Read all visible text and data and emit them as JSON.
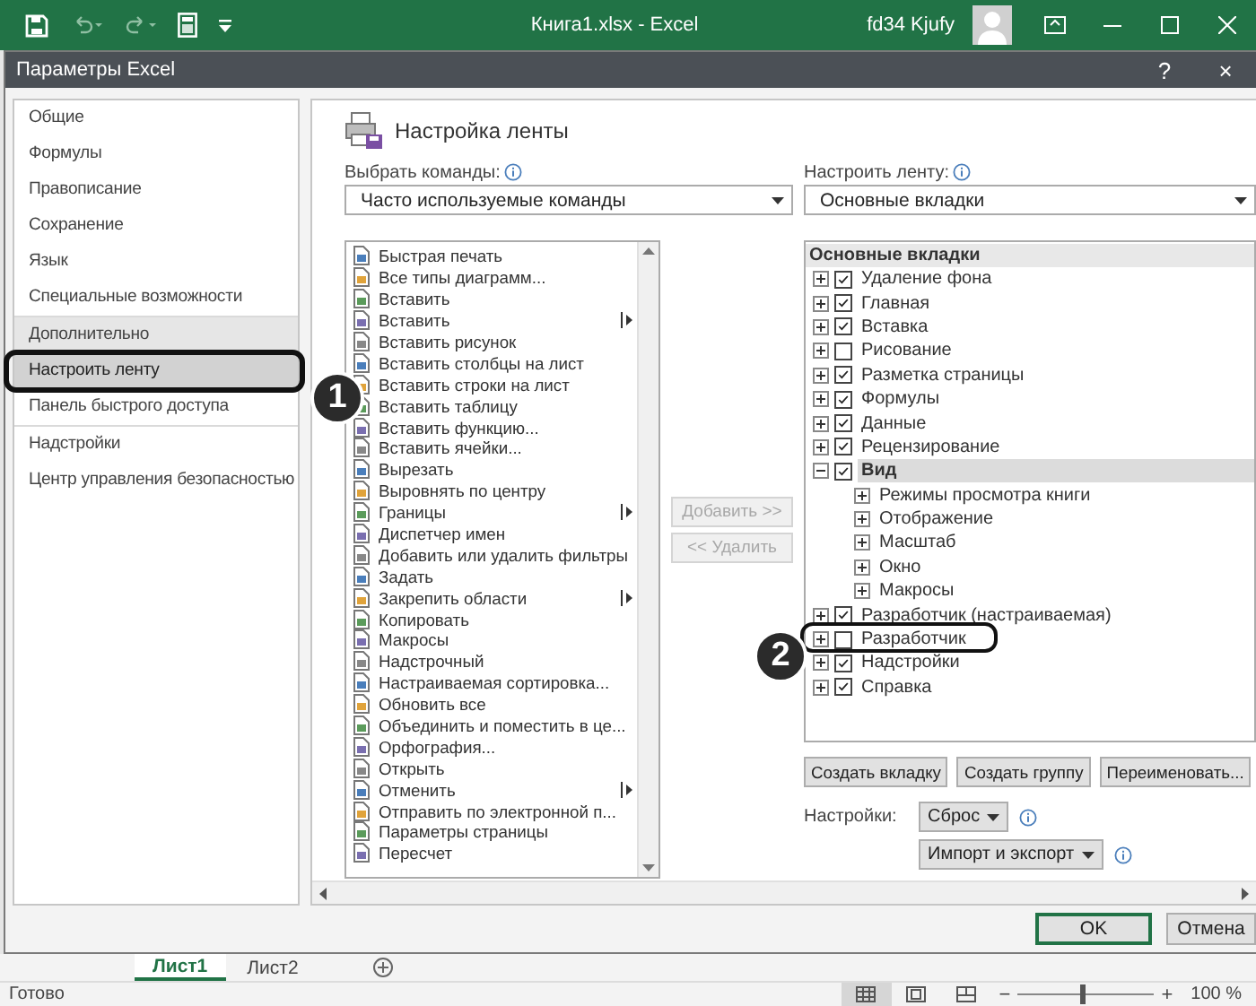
{
  "title_bar": {
    "title": "Книга1.xlsx  -  Excel",
    "user": "fd34 Kjufy"
  },
  "dialog": {
    "title": "Параметры Excel",
    "help": "?",
    "close": "×"
  },
  "nav_groups": [
    {
      "items": [
        {
          "label": "Общие",
          "selected": false,
          "highlighted": false
        },
        {
          "label": "Формулы",
          "selected": false,
          "highlighted": false
        },
        {
          "label": "Правописание",
          "selected": false,
          "highlighted": false
        },
        {
          "label": "Сохранение",
          "selected": false,
          "highlighted": false
        },
        {
          "label": "Язык",
          "selected": false,
          "highlighted": false
        },
        {
          "label": "Специальные возможности",
          "selected": false,
          "highlighted": false
        }
      ]
    },
    {
      "items": [
        {
          "label": "Дополнительно",
          "selected": false,
          "highlighted": true
        },
        {
          "label": "Настроить ленту",
          "selected": true,
          "highlighted": false
        },
        {
          "label": "Панель быстрого доступа",
          "selected": false,
          "highlighted": false
        }
      ]
    },
    {
      "items": [
        {
          "label": "Надстройки",
          "selected": false,
          "highlighted": false
        },
        {
          "label": "Центр управления безопасностью",
          "selected": false,
          "highlighted": false
        }
      ]
    }
  ],
  "section_title": "Настройка ленты",
  "commands": {
    "label": "Выбрать команды:",
    "dropdown": "Часто используемые команды",
    "items": [
      {
        "label": "Быстрая печать",
        "has_submenu": false
      },
      {
        "label": "Все типы диаграмм...",
        "has_submenu": false
      },
      {
        "label": "Вставить",
        "has_submenu": false
      },
      {
        "label": "Вставить",
        "has_submenu": true
      },
      {
        "label": "Вставить рисунок",
        "has_submenu": false
      },
      {
        "label": "Вставить столбцы на лист",
        "has_submenu": false
      },
      {
        "label": "Вставить строки на лист",
        "has_submenu": false
      },
      {
        "label": "Вставить таблицу",
        "has_submenu": false
      },
      {
        "label": "Вставить функцию...",
        "has_submenu": false
      },
      {
        "label": "Вставить ячейки...",
        "has_submenu": false
      },
      {
        "label": "Вырезать",
        "has_submenu": false
      },
      {
        "label": "Выровнять по центру",
        "has_submenu": false
      },
      {
        "label": "Границы",
        "has_submenu": true
      },
      {
        "label": "Диспетчер имен",
        "has_submenu": false
      },
      {
        "label": "Добавить или удалить фильтры",
        "has_submenu": false
      },
      {
        "label": "Задать",
        "has_submenu": false
      },
      {
        "label": "Закрепить области",
        "has_submenu": true
      },
      {
        "label": "Копировать",
        "has_submenu": false
      },
      {
        "label": "Макросы",
        "has_submenu": false
      },
      {
        "label": "Надстрочный",
        "has_submenu": false
      },
      {
        "label": "Настраиваемая сортировка...",
        "has_submenu": false
      },
      {
        "label": "Обновить все",
        "has_submenu": false
      },
      {
        "label": "Объединить и поместить в це...",
        "has_submenu": false
      },
      {
        "label": "Орфография...",
        "has_submenu": false
      },
      {
        "label": "Открыть",
        "has_submenu": false
      },
      {
        "label": "Отменить",
        "has_submenu": true
      },
      {
        "label": "Отправить по электронной п...",
        "has_submenu": false
      },
      {
        "label": "Параметры страницы",
        "has_submenu": false
      },
      {
        "label": "Пересчет",
        "has_submenu": false
      }
    ]
  },
  "add_button": {
    "label": "Добавить >>",
    "disabled": true
  },
  "remove_button": {
    "label": "<< Удалить",
    "disabled": true
  },
  "ribbon": {
    "label": "Настроить ленту:",
    "dropdown": "Основные вкладки",
    "tree_header": "Основные вкладки",
    "tabs": [
      {
        "label": "Удаление фона",
        "checked": true,
        "expanded": false,
        "selected": false
      },
      {
        "label": "Главная",
        "checked": true,
        "expanded": false,
        "selected": false
      },
      {
        "label": "Вставка",
        "checked": true,
        "expanded": false,
        "selected": false
      },
      {
        "label": "Рисование",
        "checked": false,
        "expanded": false,
        "selected": false
      },
      {
        "label": "Разметка страницы",
        "checked": true,
        "expanded": false,
        "selected": false
      },
      {
        "label": "Формулы",
        "checked": true,
        "expanded": false,
        "selected": false
      },
      {
        "label": "Данные",
        "checked": true,
        "expanded": false,
        "selected": false
      },
      {
        "label": "Рецензирование",
        "checked": true,
        "expanded": false,
        "selected": false
      },
      {
        "label": "Вид",
        "checked": true,
        "expanded": true,
        "selected": true,
        "children": [
          {
            "label": "Режимы просмотра книги",
            "expanded": false
          },
          {
            "label": "Отображение",
            "expanded": false
          },
          {
            "label": "Масштаб",
            "expanded": false
          },
          {
            "label": "Окно",
            "expanded": false
          },
          {
            "label": "Макросы",
            "expanded": false
          }
        ]
      },
      {
        "label": "Разработчик (настраиваемая)",
        "checked": true,
        "expanded": false,
        "selected": false
      },
      {
        "label": "Разработчик",
        "checked": false,
        "expanded": false,
        "selected": false
      },
      {
        "label": "Надстройки",
        "checked": true,
        "expanded": false,
        "selected": false
      },
      {
        "label": "Справка",
        "checked": true,
        "expanded": false,
        "selected": false
      }
    ]
  },
  "ribbon_buttons": [
    "Создать вкладку",
    "Создать группу",
    "Переименовать..."
  ],
  "settings": {
    "label": "Настройки:",
    "reset": "Сброс",
    "import_export": "Импорт и экспорт"
  },
  "footer_buttons": [
    {
      "label": "OK",
      "default": true
    },
    {
      "label": "Отмена",
      "default": false
    }
  ],
  "sheets": [
    {
      "label": "Лист1",
      "selected": true
    },
    {
      "label": "Лист2",
      "selected": false
    }
  ],
  "status_bar": {
    "text": "Готово",
    "views": [
      {
        "kind": "normal",
        "selected": true
      },
      {
        "kind": "page_layout",
        "selected": false
      },
      {
        "kind": "page_break",
        "selected": false
      }
    ],
    "zoom_out": "−",
    "zoom_in": "+",
    "zoom": {
      "level": 0.47
    },
    "zoom_text": "100 %"
  },
  "annotations": [
    {
      "label": "1"
    },
    {
      "label": "2"
    }
  ]
}
